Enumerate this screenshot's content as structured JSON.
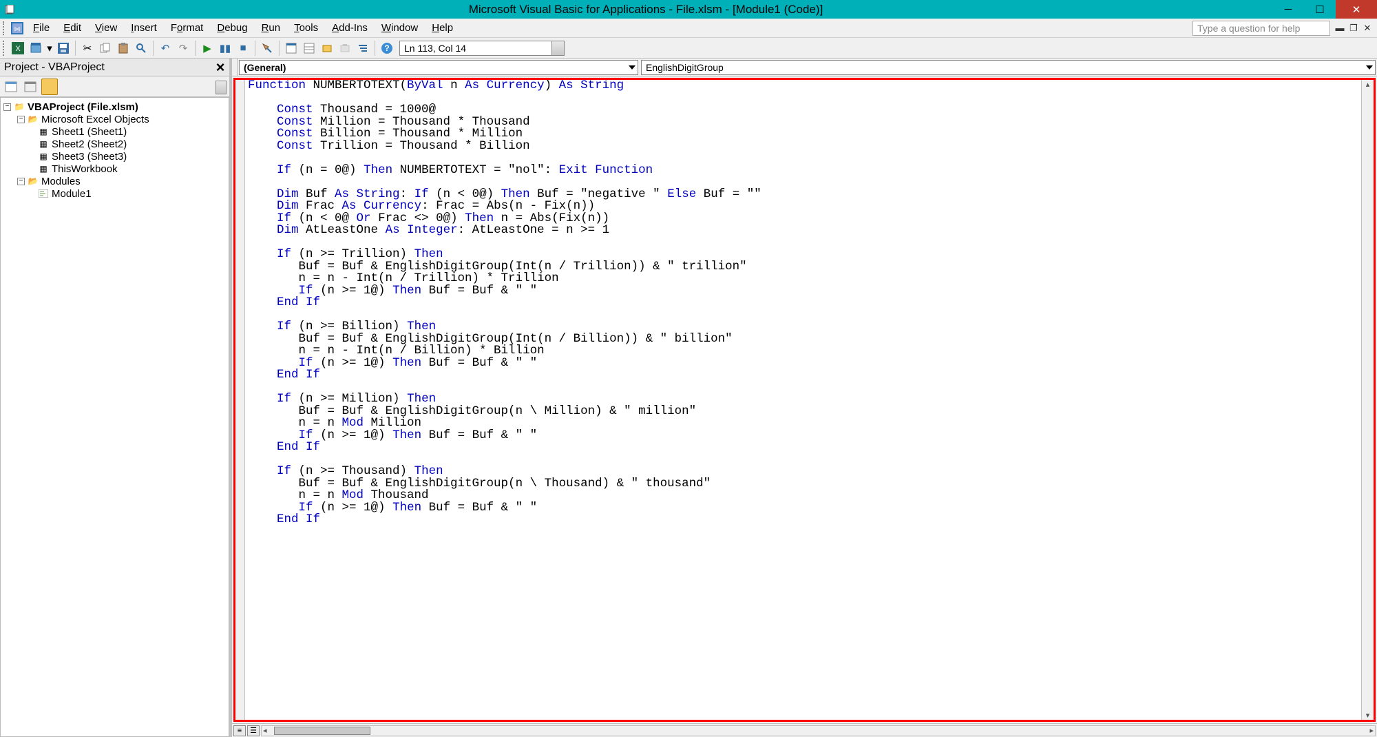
{
  "window": {
    "title": "Microsoft Visual Basic for Applications - File.xlsm - [Module1 (Code)]"
  },
  "menu": {
    "file": "File",
    "edit": "Edit",
    "view": "View",
    "insert": "Insert",
    "format": "Format",
    "debug": "Debug",
    "run": "Run",
    "tools": "Tools",
    "addins": "Add-Ins",
    "window": "Window",
    "help": "Help",
    "help_placeholder": "Type a question for help"
  },
  "toolbar": {
    "linecol": "Ln 113, Col 14"
  },
  "project_panel": {
    "title": "Project - VBAProject",
    "root": "VBAProject (File.xlsm)",
    "excel_objects": "Microsoft Excel Objects",
    "sheet1": "Sheet1 (Sheet1)",
    "sheet2": "Sheet2 (Sheet2)",
    "sheet3": "Sheet3 (Sheet3)",
    "workbook": "ThisWorkbook",
    "modules": "Modules",
    "module1": "Module1"
  },
  "code_dropdowns": {
    "left": "(General)",
    "right": "EnglishDigitGroup"
  },
  "code_tokens": [
    [
      [
        "kw",
        "Function"
      ],
      [
        "fn",
        " NUMBERTOTEXT("
      ],
      [
        "kw",
        "ByVal"
      ],
      [
        "fn",
        " n "
      ],
      [
        "kw",
        "As Currency"
      ],
      [
        "fn",
        ") "
      ],
      [
        "kw",
        "As String"
      ]
    ],
    [],
    [
      [
        "fn",
        "    "
      ],
      [
        "kw",
        "Const"
      ],
      [
        "fn",
        " Thousand = 1000@"
      ]
    ],
    [
      [
        "fn",
        "    "
      ],
      [
        "kw",
        "Const"
      ],
      [
        "fn",
        " Million = Thousand * Thousand"
      ]
    ],
    [
      [
        "fn",
        "    "
      ],
      [
        "kw",
        "Const"
      ],
      [
        "fn",
        " Billion = Thousand * Million"
      ]
    ],
    [
      [
        "fn",
        "    "
      ],
      [
        "kw",
        "Const"
      ],
      [
        "fn",
        " Trillion = Thousand * Billion"
      ]
    ],
    [],
    [
      [
        "fn",
        "    "
      ],
      [
        "kw",
        "If"
      ],
      [
        "fn",
        " (n = 0@) "
      ],
      [
        "kw",
        "Then"
      ],
      [
        "fn",
        " NUMBERTOTEXT = \"nol\": "
      ],
      [
        "kw",
        "Exit Function"
      ]
    ],
    [],
    [
      [
        "fn",
        "    "
      ],
      [
        "kw",
        "Dim"
      ],
      [
        "fn",
        " Buf "
      ],
      [
        "kw",
        "As String"
      ],
      [
        "fn",
        ": "
      ],
      [
        "kw",
        "If"
      ],
      [
        "fn",
        " (n < 0@) "
      ],
      [
        "kw",
        "Then"
      ],
      [
        "fn",
        " Buf = \"negative \" "
      ],
      [
        "kw",
        "Else"
      ],
      [
        "fn",
        " Buf = \"\""
      ]
    ],
    [
      [
        "fn",
        "    "
      ],
      [
        "kw",
        "Dim"
      ],
      [
        "fn",
        " Frac "
      ],
      [
        "kw",
        "As Currency"
      ],
      [
        "fn",
        ": Frac = Abs(n - Fix(n))"
      ]
    ],
    [
      [
        "fn",
        "    "
      ],
      [
        "kw",
        "If"
      ],
      [
        "fn",
        " (n < 0@ "
      ],
      [
        "kw",
        "Or"
      ],
      [
        "fn",
        " Frac <> 0@) "
      ],
      [
        "kw",
        "Then"
      ],
      [
        "fn",
        " n = Abs(Fix(n))"
      ]
    ],
    [
      [
        "fn",
        "    "
      ],
      [
        "kw",
        "Dim"
      ],
      [
        "fn",
        " AtLeastOne "
      ],
      [
        "kw",
        "As Integer"
      ],
      [
        "fn",
        ": AtLeastOne = n >= 1"
      ]
    ],
    [],
    [
      [
        "fn",
        "    "
      ],
      [
        "kw",
        "If"
      ],
      [
        "fn",
        " (n >= Trillion) "
      ],
      [
        "kw",
        "Then"
      ]
    ],
    [
      [
        "fn",
        "       Buf = Buf & EnglishDigitGroup(Int(n / Trillion)) & \" trillion\""
      ]
    ],
    [
      [
        "fn",
        "       n = n - Int(n / Trillion) * Trillion"
      ]
    ],
    [
      [
        "fn",
        "       "
      ],
      [
        "kw",
        "If"
      ],
      [
        "fn",
        " (n >= 1@) "
      ],
      [
        "kw",
        "Then"
      ],
      [
        "fn",
        " Buf = Buf & \" \""
      ]
    ],
    [
      [
        "fn",
        "    "
      ],
      [
        "kw",
        "End If"
      ]
    ],
    [],
    [
      [
        "fn",
        "    "
      ],
      [
        "kw",
        "If"
      ],
      [
        "fn",
        " (n >= Billion) "
      ],
      [
        "kw",
        "Then"
      ]
    ],
    [
      [
        "fn",
        "       Buf = Buf & EnglishDigitGroup(Int(n / Billion)) & \" billion\""
      ]
    ],
    [
      [
        "fn",
        "       n = n - Int(n / Billion) * Billion"
      ]
    ],
    [
      [
        "fn",
        "       "
      ],
      [
        "kw",
        "If"
      ],
      [
        "fn",
        " (n >= 1@) "
      ],
      [
        "kw",
        "Then"
      ],
      [
        "fn",
        " Buf = Buf & \" \""
      ]
    ],
    [
      [
        "fn",
        "    "
      ],
      [
        "kw",
        "End If"
      ]
    ],
    [],
    [
      [
        "fn",
        "    "
      ],
      [
        "kw",
        "If"
      ],
      [
        "fn",
        " (n >= Million) "
      ],
      [
        "kw",
        "Then"
      ]
    ],
    [
      [
        "fn",
        "       Buf = Buf & EnglishDigitGroup(n \\ Million) & \" million\""
      ]
    ],
    [
      [
        "fn",
        "       n = n "
      ],
      [
        "kw",
        "Mod"
      ],
      [
        "fn",
        " Million"
      ]
    ],
    [
      [
        "fn",
        "       "
      ],
      [
        "kw",
        "If"
      ],
      [
        "fn",
        " (n >= 1@) "
      ],
      [
        "kw",
        "Then"
      ],
      [
        "fn",
        " Buf = Buf & \" \""
      ]
    ],
    [
      [
        "fn",
        "    "
      ],
      [
        "kw",
        "End If"
      ]
    ],
    [],
    [
      [
        "fn",
        "    "
      ],
      [
        "kw",
        "If"
      ],
      [
        "fn",
        " (n >= Thousand) "
      ],
      [
        "kw",
        "Then"
      ]
    ],
    [
      [
        "fn",
        "       Buf = Buf & EnglishDigitGroup(n \\ Thousand) & \" thousand\""
      ]
    ],
    [
      [
        "fn",
        "       n = n "
      ],
      [
        "kw",
        "Mod"
      ],
      [
        "fn",
        " Thousand"
      ]
    ],
    [
      [
        "fn",
        "       "
      ],
      [
        "kw",
        "If"
      ],
      [
        "fn",
        " (n >= 1@) "
      ],
      [
        "kw",
        "Then"
      ],
      [
        "fn",
        " Buf = Buf & \" \""
      ]
    ],
    [
      [
        "fn",
        "    "
      ],
      [
        "kw",
        "End If"
      ]
    ],
    []
  ]
}
